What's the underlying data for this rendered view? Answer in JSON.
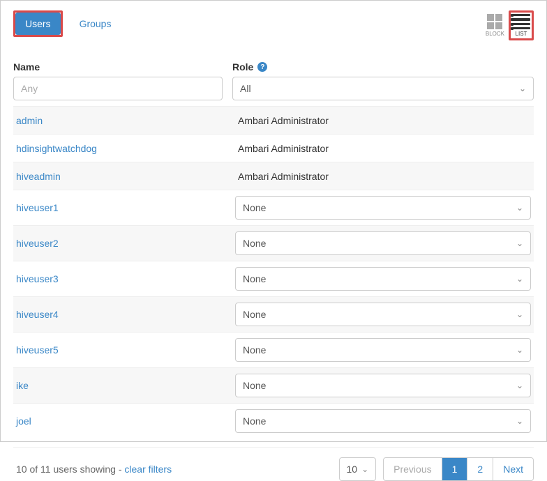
{
  "tabs": {
    "users": "Users",
    "groups": "Groups"
  },
  "view_toggle": {
    "block": "BLOCK",
    "list": "LIST"
  },
  "filters": {
    "name_header": "Name",
    "role_header": "Role",
    "name_placeholder": "Any",
    "role_selected": "All"
  },
  "rows": [
    {
      "name": "admin",
      "role_text": "Ambari Administrator",
      "editable": false
    },
    {
      "name": "hdinsightwatchdog",
      "role_text": "Ambari Administrator",
      "editable": false
    },
    {
      "name": "hiveadmin",
      "role_text": "Ambari Administrator",
      "editable": false
    },
    {
      "name": "hiveuser1",
      "role_text": "None",
      "editable": true
    },
    {
      "name": "hiveuser2",
      "role_text": "None",
      "editable": true
    },
    {
      "name": "hiveuser3",
      "role_text": "None",
      "editable": true
    },
    {
      "name": "hiveuser4",
      "role_text": "None",
      "editable": true
    },
    {
      "name": "hiveuser5",
      "role_text": "None",
      "editable": true
    },
    {
      "name": "ike",
      "role_text": "None",
      "editable": true
    },
    {
      "name": "joel",
      "role_text": "None",
      "editable": true
    }
  ],
  "footer": {
    "showing_text": "10 of 11 users showing - ",
    "clear_filters": "clear filters",
    "page_size": "10",
    "prev": "Previous",
    "pages": [
      "1",
      "2"
    ],
    "active_page": "1",
    "next": "Next"
  }
}
